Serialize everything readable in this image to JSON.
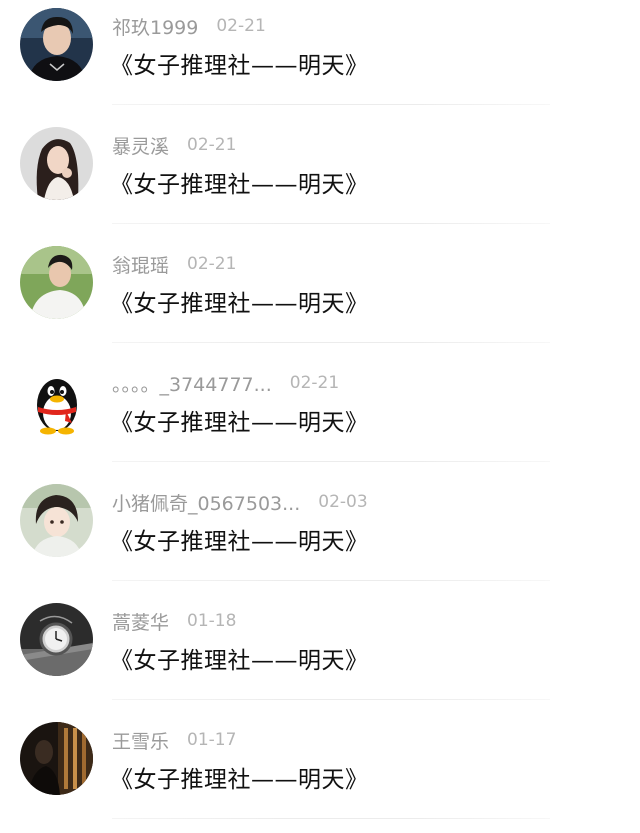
{
  "comments": [
    {
      "username": "祁玖1999",
      "date": "02-21",
      "text": "《女子推理社——明天》",
      "avatar_icon": "avatar-young-man-photo",
      "avatar_bg": "#1b2a3a"
    },
    {
      "username": "暴灵溪",
      "date": "02-21",
      "text": "《女子推理社——明天》",
      "avatar_icon": "avatar-young-woman-photo",
      "avatar_bg": "#d8d8d8"
    },
    {
      "username": "翁琨瑶",
      "date": "02-21",
      "text": "《女子推理社——明天》",
      "avatar_icon": "avatar-man-white-shirt-photo",
      "avatar_bg": "#6f9a4c"
    },
    {
      "username": "。。。。_3744777...",
      "date": "02-21",
      "text": "《女子推理社——明天》",
      "avatar_icon": "qq-penguin-icon",
      "avatar_bg": "#ffffff"
    },
    {
      "username": "小猪佩奇_0567503...",
      "date": "02-03",
      "text": "《女子推理社——明天》",
      "avatar_icon": "avatar-anime-character",
      "avatar_bg": "#cfd8c8"
    },
    {
      "username": "蒿菱华",
      "date": "01-18",
      "text": "《女子推理社——明天》",
      "avatar_icon": "avatar-pocket-watch-photo",
      "avatar_bg": "#2a2a2a"
    },
    {
      "username": "王雪乐",
      "date": "01-17",
      "text": "《女子推理社——明天》",
      "avatar_icon": "avatar-dark-portrait-photo",
      "avatar_bg": "#1a1a1a"
    }
  ]
}
